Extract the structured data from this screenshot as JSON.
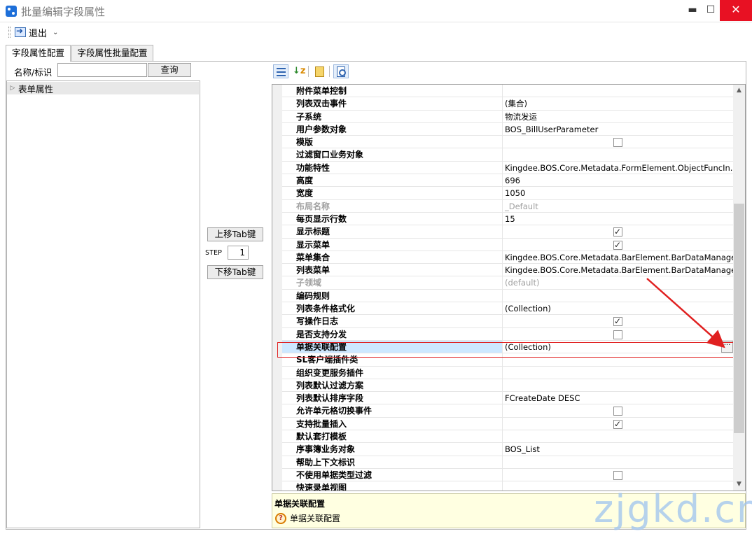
{
  "window": {
    "title": "批量编辑字段属性",
    "minimize": "▬",
    "maximize": "☐",
    "close": "✕"
  },
  "toolbar": {
    "exit_label": "退出",
    "exit_chevron": "⌄"
  },
  "tabs": [
    {
      "label": "字段属性配置",
      "active": true
    },
    {
      "label": "字段属性批量配置",
      "active": false
    }
  ],
  "search": {
    "label": "名称/标识",
    "value": "",
    "button": "查询"
  },
  "tree": {
    "items": [
      {
        "label": "表单属性",
        "expanded": false
      }
    ]
  },
  "middle": {
    "move_up": "上移Tab键",
    "step_label": "STEP",
    "step_value": "1",
    "move_down": "下移Tab键"
  },
  "property_toolbar": {
    "icons": [
      "categorized-icon",
      "alphabetical-sort-icon",
      "property-pages-icon",
      "properties-icon"
    ]
  },
  "properties": [
    {
      "name": "附件菜单控制",
      "value": ""
    },
    {
      "name": "列表双击事件",
      "value": "(集合)"
    },
    {
      "name": "子系统",
      "value": "物流发运"
    },
    {
      "name": "用户参数对象",
      "value": "BOS_BillUserParameter"
    },
    {
      "name": "模版",
      "value": "",
      "checkbox": false
    },
    {
      "name": "过滤窗口业务对象",
      "value": ""
    },
    {
      "name": "功能特性",
      "value": "Kingdee.BOS.Core.Metadata.FormElement.ObjectFuncIn..."
    },
    {
      "name": "高度",
      "value": "696"
    },
    {
      "name": "宽度",
      "value": "1050"
    },
    {
      "name": "布局名称",
      "value": "_Default",
      "disabled": true
    },
    {
      "name": "每页显示行数",
      "value": "15"
    },
    {
      "name": "显示标题",
      "value": "",
      "checkbox": true
    },
    {
      "name": "显示菜单",
      "value": "",
      "checkbox": true
    },
    {
      "name": "菜单集合",
      "value": "Kingdee.BOS.Core.Metadata.BarElement.BarDataManager"
    },
    {
      "name": "列表菜单",
      "value": "Kingdee.BOS.Core.Metadata.BarElement.BarDataManager"
    },
    {
      "name": "子领域",
      "value": "(default)",
      "disabled": true
    },
    {
      "name": "编码规则",
      "value": ""
    },
    {
      "name": "列表条件格式化",
      "value": "(Collection)"
    },
    {
      "name": "写操作日志",
      "value": "",
      "checkbox": true
    },
    {
      "name": "是否支持分发",
      "value": "",
      "checkbox": false
    },
    {
      "name": "单据关联配置",
      "value": "(Collection)",
      "selected": true,
      "ellipsis": "···"
    },
    {
      "name": "SL客户端插件类",
      "value": ""
    },
    {
      "name": "组织变更服务插件",
      "value": ""
    },
    {
      "name": "列表默认过滤方案",
      "value": ""
    },
    {
      "name": "列表默认排序字段",
      "value": "FCreateDate DESC"
    },
    {
      "name": "允许单元格切换事件",
      "value": "",
      "checkbox": false
    },
    {
      "name": "支持批量插入",
      "value": "",
      "checkbox": true
    },
    {
      "name": "默认套打模板",
      "value": ""
    },
    {
      "name": "序事簿业务对象",
      "value": "BOS_List"
    },
    {
      "name": "帮助上下文标识",
      "value": ""
    },
    {
      "name": "不使用单据类型过滤",
      "value": "",
      "checkbox": false
    },
    {
      "name": "快速录单视图",
      "value": ""
    }
  ],
  "scrollbar": {
    "up": "▲",
    "down": "▼"
  },
  "description": {
    "title": "单据关联配置",
    "text": "单据关联配置",
    "icon_glyph": "?"
  },
  "watermark": "zjgkd.cn",
  "colors": {
    "accent": "#cde8ff",
    "highlight": "#e02020",
    "desc_bg": "#ffffe1",
    "close_btn": "#e81123"
  }
}
